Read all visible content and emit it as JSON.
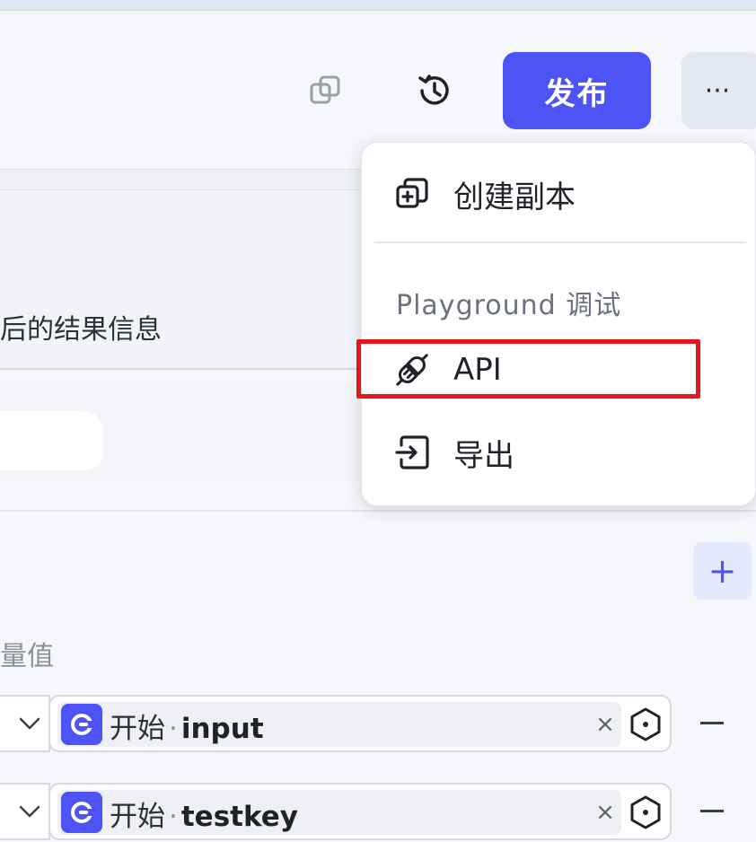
{
  "toolbar": {
    "publish_label": "发布",
    "more_label": "···",
    "icons": [
      "copy-icon",
      "history-icon"
    ]
  },
  "panel": {
    "description_fragment": "后的结果信息",
    "variable_label": "量值",
    "add_label": "+"
  },
  "params": [
    {
      "node": "开始",
      "separator": "·",
      "variable": "input",
      "clear": "×"
    },
    {
      "node": "开始",
      "separator": "·",
      "variable": "testkey",
      "clear": "×"
    }
  ],
  "menu": {
    "items": [
      {
        "label": "创建副本",
        "icon": "duplicate-icon"
      },
      {
        "label": "API",
        "icon": "plug-icon"
      },
      {
        "label": "导出",
        "icon": "export-icon"
      }
    ],
    "group_label": "Playground 调试"
  },
  "colors": {
    "accent": "#4d53f5",
    "highlight": "#e4161c",
    "background": "#f6f7fb"
  }
}
